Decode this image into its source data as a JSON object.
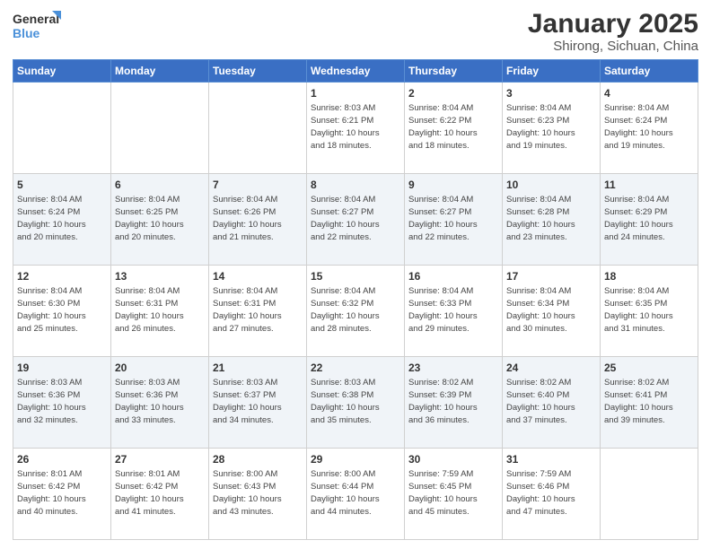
{
  "header": {
    "logo_general": "General",
    "logo_blue": "Blue",
    "title": "January 2025",
    "subtitle": "Shirong, Sichuan, China"
  },
  "days_of_week": [
    "Sunday",
    "Monday",
    "Tuesday",
    "Wednesday",
    "Thursday",
    "Friday",
    "Saturday"
  ],
  "weeks": [
    {
      "days": [
        {
          "number": "",
          "info": ""
        },
        {
          "number": "",
          "info": ""
        },
        {
          "number": "",
          "info": ""
        },
        {
          "number": "1",
          "info": "Sunrise: 8:03 AM\nSunset: 6:21 PM\nDaylight: 10 hours\nand 18 minutes."
        },
        {
          "number": "2",
          "info": "Sunrise: 8:04 AM\nSunset: 6:22 PM\nDaylight: 10 hours\nand 18 minutes."
        },
        {
          "number": "3",
          "info": "Sunrise: 8:04 AM\nSunset: 6:23 PM\nDaylight: 10 hours\nand 19 minutes."
        },
        {
          "number": "4",
          "info": "Sunrise: 8:04 AM\nSunset: 6:24 PM\nDaylight: 10 hours\nand 19 minutes."
        }
      ]
    },
    {
      "days": [
        {
          "number": "5",
          "info": "Sunrise: 8:04 AM\nSunset: 6:24 PM\nDaylight: 10 hours\nand 20 minutes."
        },
        {
          "number": "6",
          "info": "Sunrise: 8:04 AM\nSunset: 6:25 PM\nDaylight: 10 hours\nand 20 minutes."
        },
        {
          "number": "7",
          "info": "Sunrise: 8:04 AM\nSunset: 6:26 PM\nDaylight: 10 hours\nand 21 minutes."
        },
        {
          "number": "8",
          "info": "Sunrise: 8:04 AM\nSunset: 6:27 PM\nDaylight: 10 hours\nand 22 minutes."
        },
        {
          "number": "9",
          "info": "Sunrise: 8:04 AM\nSunset: 6:27 PM\nDaylight: 10 hours\nand 22 minutes."
        },
        {
          "number": "10",
          "info": "Sunrise: 8:04 AM\nSunset: 6:28 PM\nDaylight: 10 hours\nand 23 minutes."
        },
        {
          "number": "11",
          "info": "Sunrise: 8:04 AM\nSunset: 6:29 PM\nDaylight: 10 hours\nand 24 minutes."
        }
      ]
    },
    {
      "days": [
        {
          "number": "12",
          "info": "Sunrise: 8:04 AM\nSunset: 6:30 PM\nDaylight: 10 hours\nand 25 minutes."
        },
        {
          "number": "13",
          "info": "Sunrise: 8:04 AM\nSunset: 6:31 PM\nDaylight: 10 hours\nand 26 minutes."
        },
        {
          "number": "14",
          "info": "Sunrise: 8:04 AM\nSunset: 6:31 PM\nDaylight: 10 hours\nand 27 minutes."
        },
        {
          "number": "15",
          "info": "Sunrise: 8:04 AM\nSunset: 6:32 PM\nDaylight: 10 hours\nand 28 minutes."
        },
        {
          "number": "16",
          "info": "Sunrise: 8:04 AM\nSunset: 6:33 PM\nDaylight: 10 hours\nand 29 minutes."
        },
        {
          "number": "17",
          "info": "Sunrise: 8:04 AM\nSunset: 6:34 PM\nDaylight: 10 hours\nand 30 minutes."
        },
        {
          "number": "18",
          "info": "Sunrise: 8:04 AM\nSunset: 6:35 PM\nDaylight: 10 hours\nand 31 minutes."
        }
      ]
    },
    {
      "days": [
        {
          "number": "19",
          "info": "Sunrise: 8:03 AM\nSunset: 6:36 PM\nDaylight: 10 hours\nand 32 minutes."
        },
        {
          "number": "20",
          "info": "Sunrise: 8:03 AM\nSunset: 6:36 PM\nDaylight: 10 hours\nand 33 minutes."
        },
        {
          "number": "21",
          "info": "Sunrise: 8:03 AM\nSunset: 6:37 PM\nDaylight: 10 hours\nand 34 minutes."
        },
        {
          "number": "22",
          "info": "Sunrise: 8:03 AM\nSunset: 6:38 PM\nDaylight: 10 hours\nand 35 minutes."
        },
        {
          "number": "23",
          "info": "Sunrise: 8:02 AM\nSunset: 6:39 PM\nDaylight: 10 hours\nand 36 minutes."
        },
        {
          "number": "24",
          "info": "Sunrise: 8:02 AM\nSunset: 6:40 PM\nDaylight: 10 hours\nand 37 minutes."
        },
        {
          "number": "25",
          "info": "Sunrise: 8:02 AM\nSunset: 6:41 PM\nDaylight: 10 hours\nand 39 minutes."
        }
      ]
    },
    {
      "days": [
        {
          "number": "26",
          "info": "Sunrise: 8:01 AM\nSunset: 6:42 PM\nDaylight: 10 hours\nand 40 minutes."
        },
        {
          "number": "27",
          "info": "Sunrise: 8:01 AM\nSunset: 6:42 PM\nDaylight: 10 hours\nand 41 minutes."
        },
        {
          "number": "28",
          "info": "Sunrise: 8:00 AM\nSunset: 6:43 PM\nDaylight: 10 hours\nand 43 minutes."
        },
        {
          "number": "29",
          "info": "Sunrise: 8:00 AM\nSunset: 6:44 PM\nDaylight: 10 hours\nand 44 minutes."
        },
        {
          "number": "30",
          "info": "Sunrise: 7:59 AM\nSunset: 6:45 PM\nDaylight: 10 hours\nand 45 minutes."
        },
        {
          "number": "31",
          "info": "Sunrise: 7:59 AM\nSunset: 6:46 PM\nDaylight: 10 hours\nand 47 minutes."
        },
        {
          "number": "",
          "info": ""
        }
      ]
    }
  ]
}
